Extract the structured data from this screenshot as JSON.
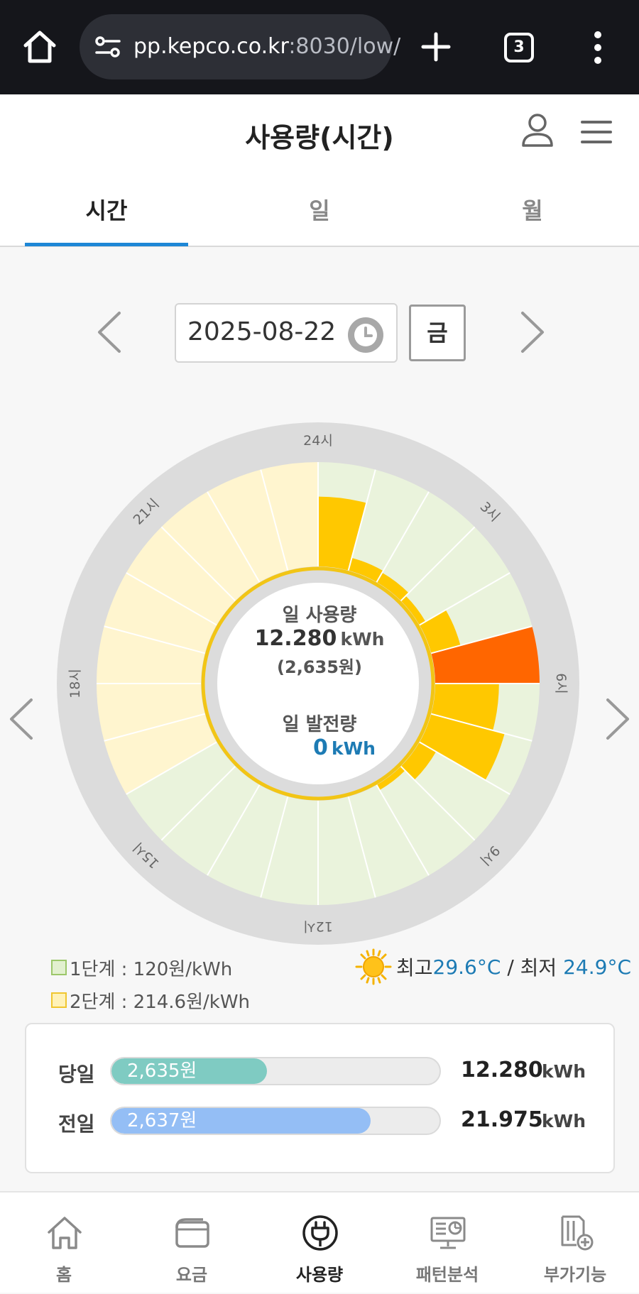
{
  "browser": {
    "url_host": "pp.kepco.co.kr",
    "url_rest": ":8030/low/",
    "tab_count": "3"
  },
  "header": {
    "title": "사용량(시간)"
  },
  "tabs": [
    {
      "label": "시간",
      "active": true
    },
    {
      "label": "일",
      "active": false
    },
    {
      "label": "월",
      "active": false
    }
  ],
  "date": {
    "value": "2025-08-22",
    "weekday": "금"
  },
  "dial": {
    "hour_labels": [
      "24시",
      "3시",
      "6시",
      "9시",
      "12시",
      "15시",
      "18시",
      "21시"
    ],
    "usage_title": "일 사용량",
    "usage_value": "12.280",
    "usage_unit": "kWh",
    "usage_cost": "(2,635원)",
    "gen_title": "일 발전량",
    "gen_value": "0",
    "gen_unit": "kWh"
  },
  "chart_data": {
    "type": "radial-bar",
    "hours": [
      1,
      2,
      3,
      4,
      5,
      6,
      7,
      8,
      9,
      10,
      11,
      12,
      13,
      14,
      15,
      16,
      17,
      18,
      19,
      20,
      21,
      22,
      23,
      24
    ],
    "usage_level": [
      0.66,
      0.1,
      0.08,
      0.04,
      0.27,
      1.0,
      0.6,
      0.72,
      0.16,
      0.03,
      0.0,
      0.0,
      0.0,
      0.0,
      0.0,
      0.0,
      0.0,
      0.0,
      0.0,
      0.0,
      0.0,
      0.0,
      0.0,
      0.0
    ],
    "tier": [
      "1단계",
      "1단계",
      "1단계",
      "1단계",
      "1단계",
      "1단계",
      "1단계",
      "1단계",
      "1단계",
      "1단계",
      "1단계",
      "1단계",
      "1단계",
      "1단계",
      "1단계",
      "1단계",
      "2단계",
      "2단계",
      "2단계",
      "2단계",
      "2단계",
      "2단계",
      "2단계",
      "2단계"
    ],
    "colors": {
      "tier1_bg": "#eaf3dc",
      "tier2_bg": "#fff5cf",
      "usage": "#ffc800",
      "peak": "#ff6600",
      "ring": "#dcdcdc",
      "inner_ring": "#f2c515"
    }
  },
  "legend": [
    {
      "label": "1단계 : 120원/kWh",
      "fill": "#e2f0cf",
      "border": "#9cc76a"
    },
    {
      "label": "2단계 : 214.6원/kWh",
      "fill": "#fff2b8",
      "border": "#f0c630"
    }
  ],
  "weather": {
    "high_label": "최고",
    "high_value": "29.6°C",
    "separator": " / ",
    "low_label": "최저 ",
    "low_value": "24.9°C"
  },
  "compare": [
    {
      "label": "당일",
      "cost": "2,635원",
      "value": "12.280",
      "unit": "kWh",
      "fraction": 0.475,
      "color": "#7fcbc2"
    },
    {
      "label": "전일",
      "cost": "2,637원",
      "value": "21.975",
      "unit": "kWh",
      "fraction": 0.79,
      "color": "#94bef5"
    }
  ],
  "nav": [
    {
      "label": "홈",
      "icon": "home-icon",
      "active": false
    },
    {
      "label": "요금",
      "icon": "wallet-icon",
      "active": false
    },
    {
      "label": "사용량",
      "icon": "plug-icon",
      "active": true
    },
    {
      "label": "패턴분석",
      "icon": "monitor-chart-icon",
      "active": false
    },
    {
      "label": "부가기능",
      "icon": "document-plus-icon",
      "active": false
    }
  ]
}
